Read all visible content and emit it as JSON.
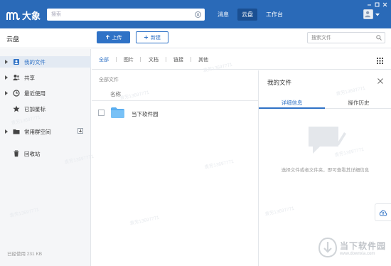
{
  "app": {
    "name": "大象"
  },
  "topbar": {
    "search_placeholder": "搜索",
    "tabs": [
      {
        "label": "消息",
        "active": false
      },
      {
        "label": "云盘",
        "active": true
      },
      {
        "label": "工作台",
        "active": false
      }
    ]
  },
  "toolbar": {
    "title": "云盘",
    "upload_label": "上传",
    "new_label": "新建",
    "search_placeholder": "搜索文件"
  },
  "sidebar": {
    "items": [
      {
        "label": "我的文件",
        "icon": "my-files-icon",
        "active": true,
        "has_caret": true
      },
      {
        "label": "共享",
        "icon": "share-icon",
        "active": false,
        "has_caret": true
      },
      {
        "label": "最近使用",
        "icon": "clock-icon",
        "active": false,
        "has_caret": true
      },
      {
        "label": "已加星标",
        "icon": "star-icon",
        "active": false,
        "has_caret": false
      },
      {
        "label": "常用群空间",
        "icon": "folder-icon",
        "active": false,
        "has_caret": true
      },
      {
        "label": "回收站",
        "icon": "trash-icon",
        "active": false,
        "has_caret": false
      }
    ],
    "storage_used": "已经使用  231 KB"
  },
  "filters": [
    {
      "label": "全部",
      "active": true
    },
    {
      "label": "图片",
      "active": false
    },
    {
      "label": "文档",
      "active": false
    },
    {
      "label": "链接",
      "active": false
    },
    {
      "label": "其他",
      "active": false
    }
  ],
  "filelist": {
    "breadcrumb": "全部文件",
    "column_name": "名称",
    "rows": [
      {
        "name": "当下软件园",
        "type": "folder"
      }
    ]
  },
  "detail": {
    "title": "我的文件",
    "tabs": [
      "详细信息",
      "操作历史"
    ],
    "empty_text": "选择文件或者文件夹，即可查看其详细信息"
  },
  "watermark": "袁芳13697771",
  "brand": {
    "name": "当下软件园",
    "url": "www.downxia.com"
  },
  "colors": {
    "primary": "#2a6ab8",
    "accent": "#2f72c6",
    "sidebar_bg": "#f5f6f8"
  }
}
